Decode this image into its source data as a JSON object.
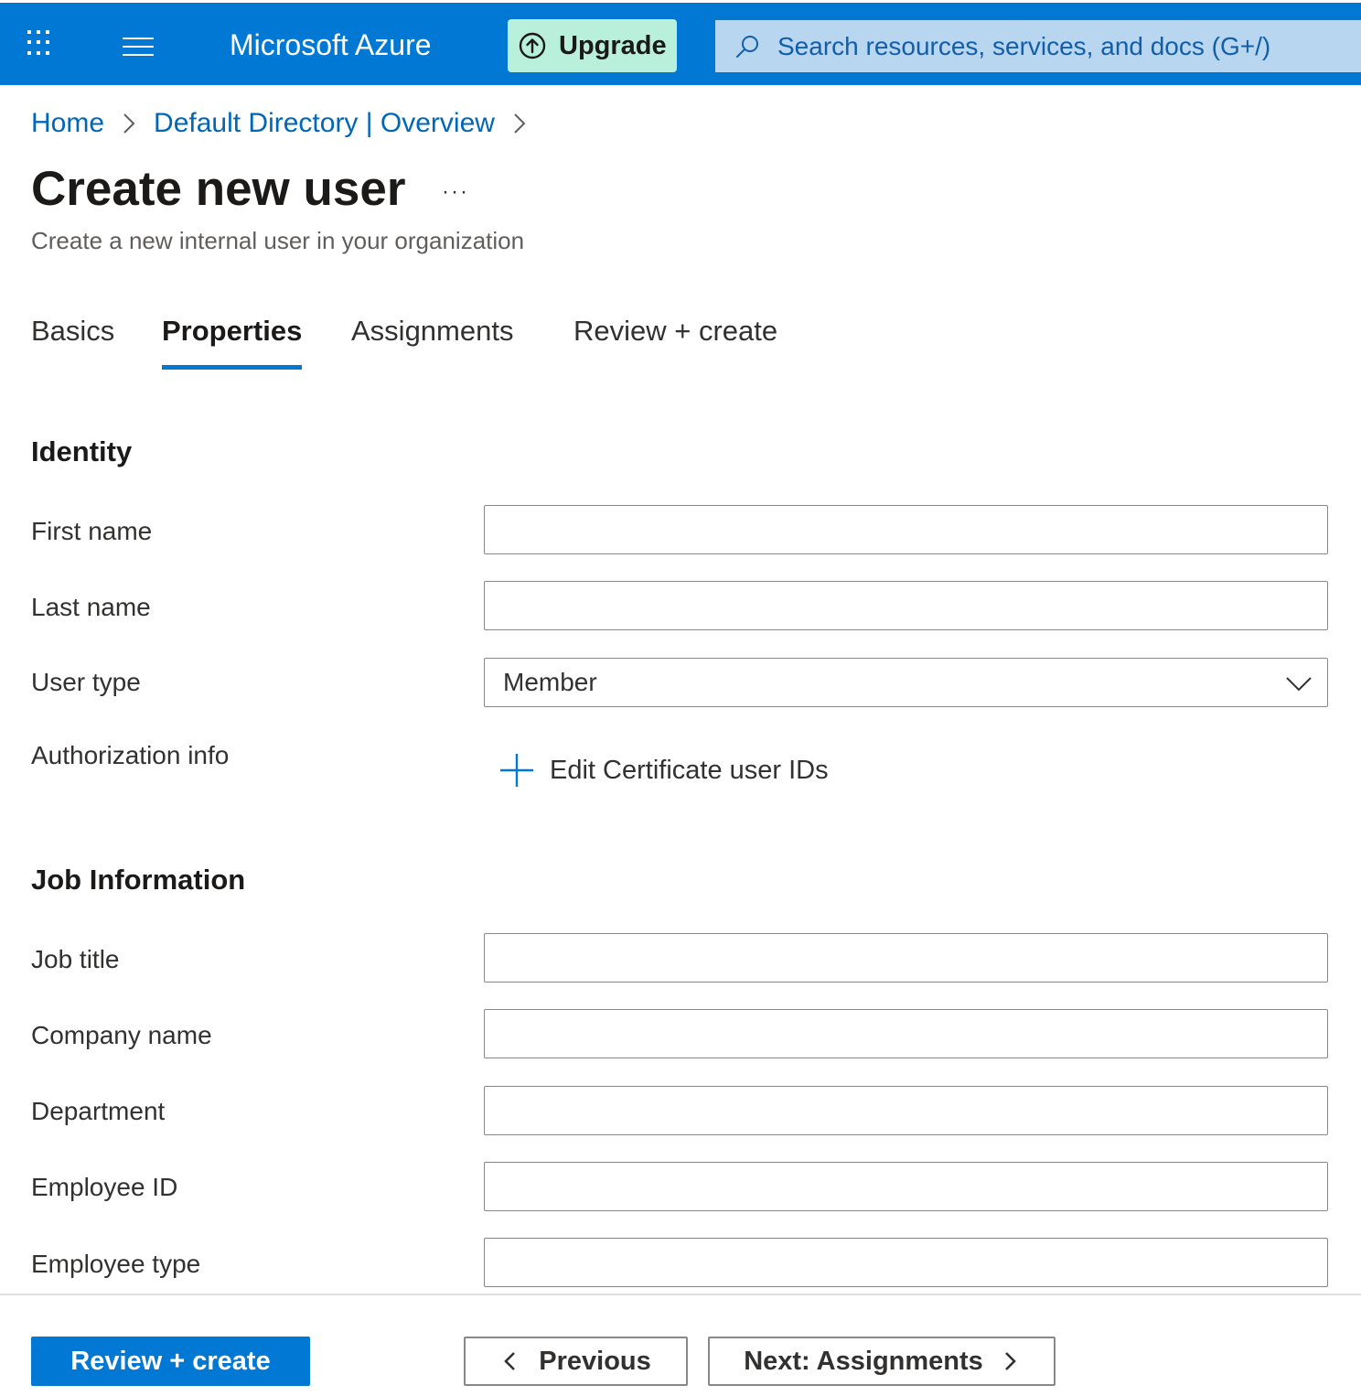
{
  "header": {
    "app_launcher_icon": "waffle-grid-icon",
    "menu_icon": "hamburger-menu-icon",
    "brand": "Microsoft Azure",
    "upgrade_label": "Upgrade",
    "upgrade_icon": "arrow-up-circle-icon",
    "search_placeholder": "Search resources, services, and docs (G+/)",
    "search_icon": "search-icon",
    "colors": {
      "bar": "#0078d4",
      "upgrade_bg": "#b8f0dc",
      "search_bg": "#b9d6f0"
    }
  },
  "breadcrumb": {
    "items": [
      "Home",
      "Default Directory | Overview"
    ],
    "separator_icon": "chevron-right-icon"
  },
  "page": {
    "title": "Create new user",
    "more_label": "···",
    "subtitle": "Create a new internal user in your organization"
  },
  "tabs": {
    "items": [
      "Basics",
      "Properties",
      "Assignments",
      "Review + create"
    ],
    "active": "Properties"
  },
  "identity": {
    "section_title": "Identity",
    "first_name_label": "First name",
    "first_name_value": "",
    "last_name_label": "Last name",
    "last_name_value": "",
    "user_type_label": "User type",
    "user_type_value": "Member",
    "authorization_label": "Authorization info",
    "edit_cert_label": "Edit Certificate user IDs"
  },
  "job": {
    "section_title": "Job Information",
    "job_title_label": "Job title",
    "job_title_value": "",
    "company_name_label": "Company name",
    "company_name_value": "",
    "department_label": "Department",
    "department_value": "",
    "employee_id_label": "Employee ID",
    "employee_id_value": "",
    "employee_type_label": "Employee type",
    "employee_type_value": ""
  },
  "footer": {
    "review_create_label": "Review + create",
    "previous_label": "Previous",
    "next_label": "Next: Assignments",
    "primary_color": "#0078d4"
  }
}
